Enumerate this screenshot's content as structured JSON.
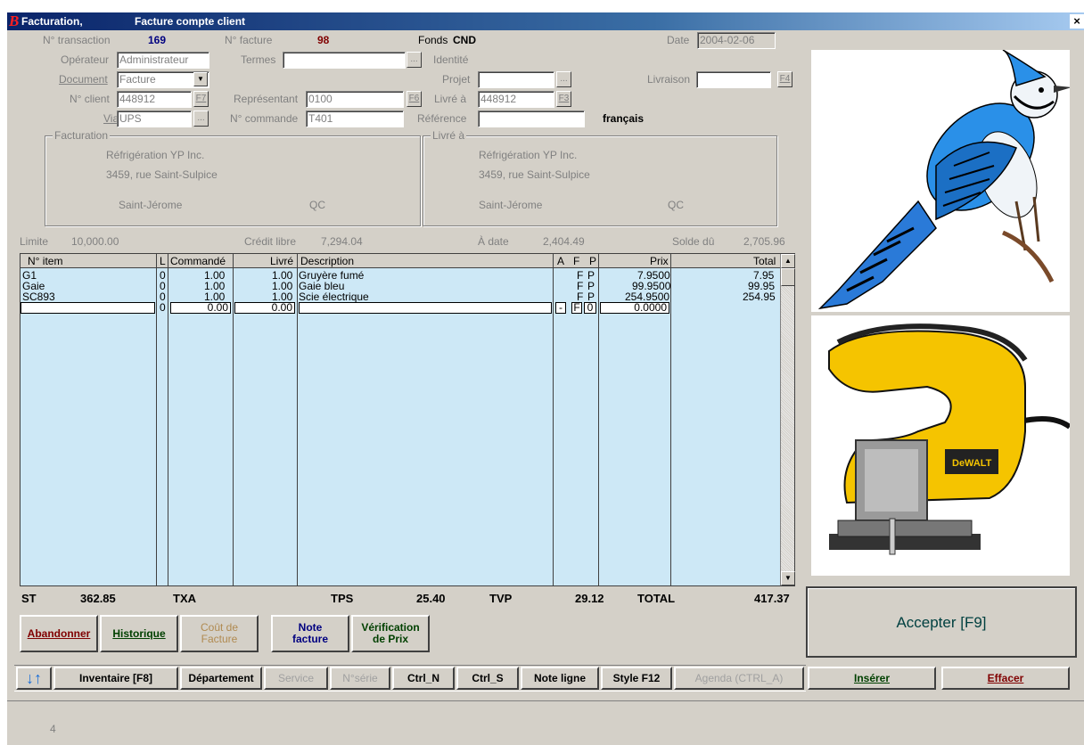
{
  "window": {
    "title_left": "Facturation,",
    "title_right": "Facture compte client",
    "logo_letter": "B",
    "close_glyph": "×"
  },
  "header": {
    "transaction_label": "N° transaction",
    "transaction_value": "169",
    "invoice_label": "N° facture",
    "invoice_value": "98",
    "fonds_label": "Fonds",
    "fonds_value": "CND",
    "date_label": "Date",
    "date_value": "2004-02-06"
  },
  "form": {
    "operator_label": "Opérateur",
    "operator_value": "Administrateur",
    "terms_label": "Termes",
    "terms_value": "",
    "identity_label": "Identité",
    "document_label": "Document",
    "document_value": "Facture",
    "project_label": "Projet",
    "project_value": "",
    "delivery_label": "Livraison",
    "delivery_value": "",
    "delivery_key": "F4",
    "client_label": "N° client",
    "client_value": "448912",
    "client_key": "F7",
    "rep_label": "Représentant",
    "rep_value": "0100",
    "rep_key": "F6",
    "shipto_label": "Livré à",
    "shipto_value": "448912",
    "shipto_key": "F3",
    "via_label": "Via",
    "via_value": "UPS",
    "order_label": "N° commande",
    "order_value": "T401",
    "ref_label": "Référence",
    "ref_value": "",
    "language": "français",
    "ellipsis": "...",
    "dropdown_glyph": "▼"
  },
  "billing": {
    "caption": "Facturation",
    "name": "Réfrigération YP Inc.",
    "street": "3459, rue Saint-Sulpice",
    "city": "Saint-Jérome",
    "prov": "QC"
  },
  "shipping": {
    "caption": "Livré à",
    "name": "Réfrigération YP Inc.",
    "street": "3459, rue Saint-Sulpice",
    "city": "Saint-Jérome",
    "prov": "QC"
  },
  "credit": {
    "limit_label": "Limite",
    "limit_value": "10,000.00",
    "free_label": "Crédit libre",
    "free_value": "7,294.04",
    "todate_label": "À date",
    "todate_value": "2,404.49",
    "balance_label": "Solde dû",
    "balance_value": "2,705.96"
  },
  "grid": {
    "headers": [
      "N° item",
      "L",
      "Commandé",
      "Livré",
      "Description",
      "A",
      "F",
      "P",
      "Prix",
      "Total"
    ],
    "rows": [
      {
        "item": "G1",
        "l": "0",
        "ordered": "1.00",
        "delivered": "1.00",
        "desc": "Gruyère fumé",
        "a": "",
        "f": "F",
        "p": "P",
        "price": "7.9500",
        "total": "7.95"
      },
      {
        "item": "Gaie",
        "l": "0",
        "ordered": "1.00",
        "delivered": "1.00",
        "desc": "Gaie bleu",
        "a": "",
        "f": "F",
        "p": "P",
        "price": "99.9500",
        "total": "99.95"
      },
      {
        "item": "SC893",
        "l": "0",
        "ordered": "1.00",
        "delivered": "1.00",
        "desc": "Scie électrique",
        "a": "",
        "f": "F",
        "p": "P",
        "price": "254.9500",
        "total": "254.95"
      },
      {
        "item": "",
        "l": "0",
        "ordered": "0.00",
        "delivered": "0.00",
        "desc": "",
        "a": "-",
        "f": "F",
        "p": "0",
        "price": "0.0000",
        "total": ""
      }
    ],
    "scroll_up": "▲",
    "scroll_down": "▼"
  },
  "totals": {
    "st_label": "ST",
    "st_value": "362.85",
    "txa_label": "TXA",
    "tps_label": "TPS",
    "tps_value": "25.40",
    "tvp_label": "TVP",
    "tvp_value": "29.12",
    "total_label": "TOTAL",
    "total_value": "417.37"
  },
  "actions": {
    "abandon": "Abandonner",
    "history": "Historique",
    "cost_line1": "Coût de",
    "cost_line2": "Facture",
    "note_line1": "Note",
    "note_line2": "facture",
    "verify_line1": "Vérification",
    "verify_line2": "de Prix",
    "accept": "Accepter [F9]"
  },
  "toolbar": {
    "down_arrow": "↓",
    "up_arrow": "↑",
    "inventory": "Inventaire  [F8]",
    "department": "Département",
    "service": "Service",
    "serial": "N°série",
    "ctrl_n": "Ctrl_N",
    "ctrl_s": "Ctrl_S",
    "note_line": "Note ligne",
    "style": "Style F12",
    "agenda": "Agenda (CTRL_A)",
    "insert": "Insérer",
    "erase": "Effacer"
  },
  "status": {
    "text": "4"
  },
  "colors": {
    "title_bar": "#0a246a",
    "grid_bg": "#cde8f6",
    "window_bg": "#d4d0c8"
  }
}
